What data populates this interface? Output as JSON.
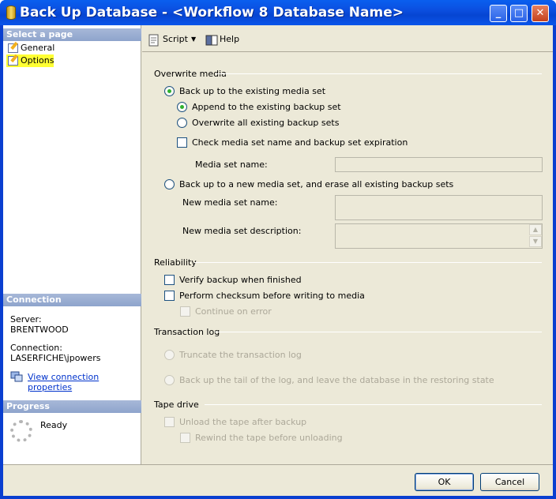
{
  "window": {
    "title": "Back Up Database - <Workflow 8 Database Name>",
    "controls": {
      "minimize": "_",
      "maximize": "□",
      "close": "✕"
    }
  },
  "left": {
    "select_page_header": "Select a page",
    "pages": [
      {
        "label": "General",
        "icon": "page-icon"
      },
      {
        "label": "Options",
        "icon": "page-icon",
        "selected": true
      }
    ],
    "connection_header": "Connection",
    "server_label": "Server:",
    "server_value": "BRENTWOOD",
    "connection_label": "Connection:",
    "connection_value": "LASERFICHE\\jpowers",
    "view_connection_link": "View connection properties",
    "progress_header": "Progress",
    "progress_status": "Ready"
  },
  "toolbar": {
    "script_label": "Script",
    "help_label": "Help"
  },
  "overwrite": {
    "title": "Overwrite media",
    "existing_set": "Back up to the existing media set",
    "append": "Append to the existing backup set",
    "overwrite_all": "Overwrite all existing backup sets",
    "check_media": "Check media set name and backup set expiration",
    "media_set_name_label": "Media set name:",
    "media_set_name_value": "",
    "new_set": "Back up to a new media set, and erase all existing backup sets",
    "new_name_label": "New media set name:",
    "new_name_value": "",
    "new_desc_label": "New media set description:",
    "new_desc_value": ""
  },
  "reliability": {
    "title": "Reliability",
    "verify": "Verify backup when finished",
    "checksum": "Perform checksum before writing to media",
    "continue_on_error": "Continue on error"
  },
  "transaction_log": {
    "title": "Transaction log",
    "truncate": "Truncate the transaction log",
    "tail": "Back up the tail of the log, and leave the database in the restoring state"
  },
  "tape": {
    "title": "Tape drive",
    "unload": "Unload the tape after backup",
    "rewind": "Rewind the tape before unloading"
  },
  "buttons": {
    "ok": "OK",
    "cancel": "Cancel"
  },
  "colors": {
    "titlebar": "#0a55ea",
    "selected_page": "#ffff33",
    "section_header": "#8ea4cc",
    "link": "#0033cc"
  }
}
